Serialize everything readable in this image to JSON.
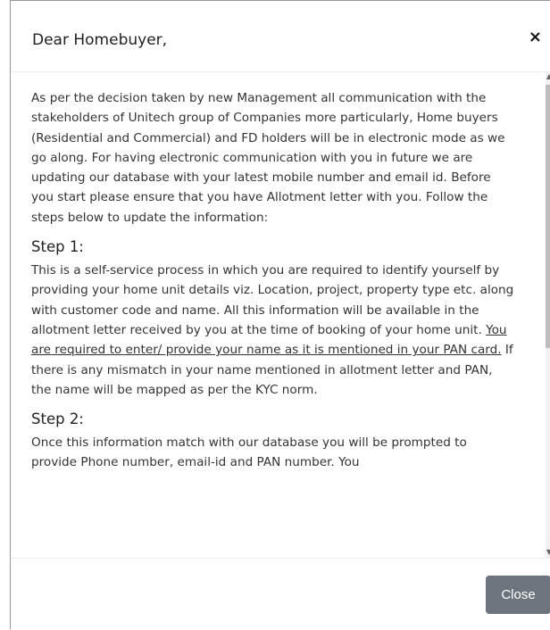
{
  "modal": {
    "title": "Dear Homebuyer,",
    "close_icon": "×",
    "intro": "As per the decision taken by new Management all communication with the stakeholders of Unitech group of Companies more particularly, Home buyers (Residential and Commercial) and FD holders will be in electronic mode as we go along. For having electronic communication with you in future we are updating our database with your latest mobile number and email id. Before you start please ensure that you have Allotment letter with you. Follow the steps below to update the information:",
    "step1": {
      "heading": "Step 1:",
      "text_before": "This is a self-service process in which you are required to identify yourself by providing your home unit details viz. Location, project, property type etc. along with customer code and name. All this information will be available in the allotment letter received by you at the time of booking of your home unit. ",
      "text_underlined": "You are required to enter/ provide your name as it is mentioned in your PAN card.",
      "text_after": " If there is any mismatch in your name mentioned in allotment letter and PAN, the name will be mapped as per the KYC norm."
    },
    "step2": {
      "heading": "Step 2:",
      "text": "Once this information match with our database you will be prompted to provide Phone number, email-id and PAN number. You"
    },
    "footer": {
      "close_label": "Close"
    }
  }
}
